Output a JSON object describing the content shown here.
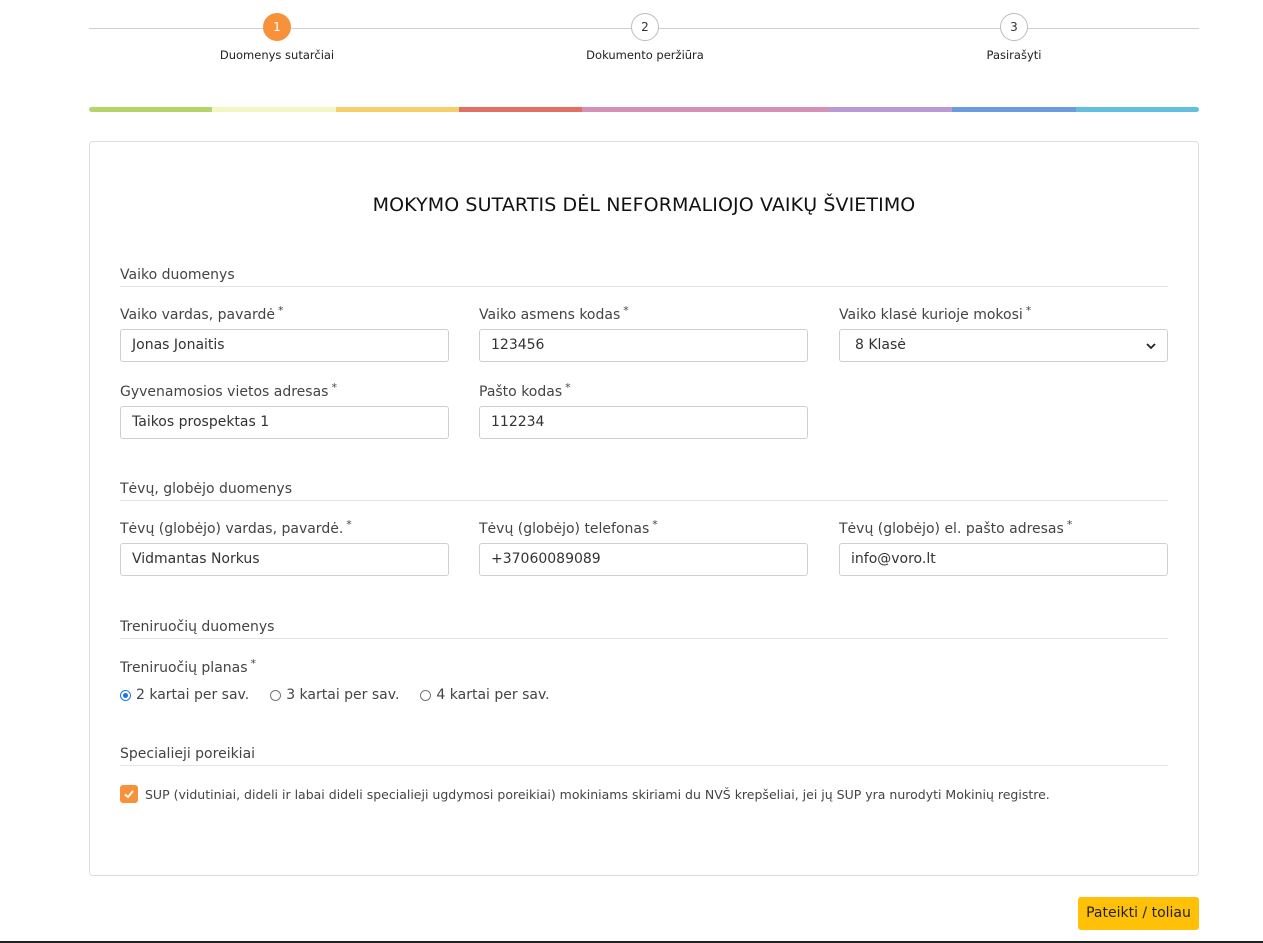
{
  "stepper": {
    "steps": [
      {
        "number": "1",
        "label": "Duomenys sutarčiai"
      },
      {
        "number": "2",
        "label": "Dokumento peržiūra"
      },
      {
        "number": "3",
        "label": "Pasirašyti"
      }
    ],
    "active_step": 1
  },
  "colorbar": [
    "#b5d56a",
    "#f3f5c2",
    "#f5cf6b",
    "#e36f63",
    "#d68fb8",
    "#d68fb8",
    "#b99ad6",
    "#6b9be0",
    "#62bfe0"
  ],
  "form": {
    "title": "MOKYMO SUTARTIS DĖL NEFORMALIOJO VAIKŲ ŠVIETIMO",
    "required_mark": "*",
    "sections": {
      "child": "Vaiko duomenys",
      "parent": "Tėvų, globėjo duomenys",
      "training": "Treniruočių duomenys",
      "special": "Specialieji poreikiai"
    },
    "child": {
      "name_label": "Vaiko vardas, pavardė",
      "name_value": "Jonas Jonaitis",
      "code_label": "Vaiko asmens kodas",
      "code_value": "123456",
      "class_label": "Vaiko klasė kurioje mokosi",
      "class_value": "8 Klasė",
      "address_label": "Gyvenamosios vietos adresas",
      "address_value": "Taikos prospektas 1",
      "postal_label": "Pašto kodas",
      "postal_value": "112234"
    },
    "parent": {
      "name_label": "Tėvų (globėjo) vardas, pavardė.",
      "name_value": "Vidmantas Norkus",
      "phone_label": "Tėvų (globėjo) telefonas",
      "phone_value": "+37060089089",
      "email_label": "Tėvų (globėjo) el. pašto adresas",
      "email_value": "info@voro.lt"
    },
    "training": {
      "plan_label": "Treniruočių planas",
      "options": [
        "2 kartai per sav.",
        "3 kartai per sav.",
        "4 kartai per sav."
      ],
      "selected": "2 kartai per sav."
    },
    "special": {
      "checkbox_label": "SUP (vidutiniai, dideli ir labai dideli specialieji ugdymosi poreikiai) mokiniams skiriami du NVŠ krepšeliai, jei jų SUP yra nurodyti Mokinių registre.",
      "checked": true
    },
    "submit_label": "Pateikti / toliau"
  },
  "colors": {
    "accent": "#f7923a",
    "submit": "#ffc107",
    "radio": "#1a73e8"
  }
}
